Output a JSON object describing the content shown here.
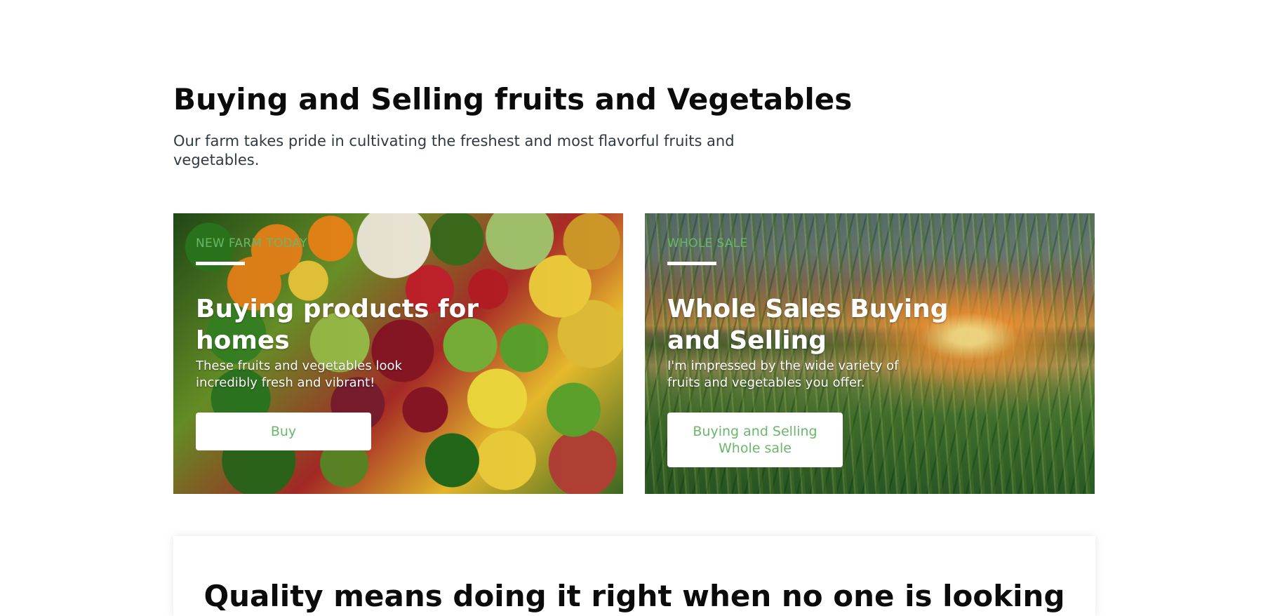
{
  "section": {
    "title": "Buying and Selling fruits and Vegetables",
    "subtitle": "Our farm takes pride in cultivating the freshest and most flavorful fruits and vegetables."
  },
  "cards": [
    {
      "kicker": "NEW FARM TODAY",
      "title": "Buying products for homes",
      "description": "These fruits and vegetables look incredibly fresh and vibrant!",
      "button": "Buy"
    },
    {
      "kicker": "WHOLE SALE",
      "title": "Whole Sales Buying and Selling",
      "description": "I'm impressed by the wide variety of fruits and vegetables you offer.",
      "button": "Buying and Selling Whole sale"
    }
  ],
  "quality": {
    "title": "Quality means doing it right when no one is looking"
  },
  "colors": {
    "accent": "#67b86b",
    "text_dark": "#0b0b0b",
    "text_muted": "#2f3a45",
    "card_text": "#ffffff",
    "background": "#ffffff"
  }
}
